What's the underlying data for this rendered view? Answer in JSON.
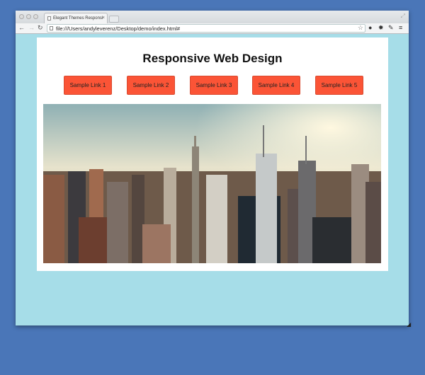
{
  "browser": {
    "tab_title": "Elegant Themes Responsi",
    "url": "file:///Users/andyleverenz/Desktop/demo/index.html#"
  },
  "page": {
    "title": "Responsive Web Design",
    "links": [
      "Sample Link 1",
      "Sample Link 2",
      "Sample Link 3",
      "Sample Link 4",
      "Sample Link 5"
    ],
    "hero_image": "city-skyline"
  },
  "colors": {
    "background": "#a6dde8",
    "button": "#fb5436"
  }
}
